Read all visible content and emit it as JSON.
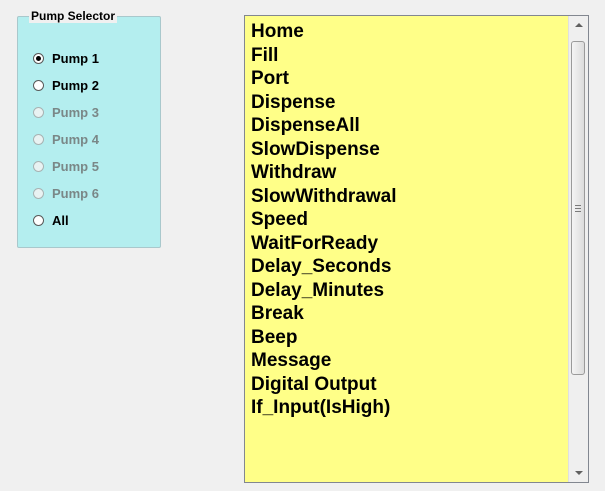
{
  "pump_selector": {
    "title": "Pump Selector",
    "options": [
      {
        "label": "Pump 1",
        "checked": true,
        "enabled": true
      },
      {
        "label": "Pump 2",
        "checked": false,
        "enabled": true
      },
      {
        "label": "Pump 3",
        "checked": false,
        "enabled": false
      },
      {
        "label": "Pump 4",
        "checked": false,
        "enabled": false
      },
      {
        "label": "Pump 5",
        "checked": false,
        "enabled": false
      },
      {
        "label": "Pump 6",
        "checked": false,
        "enabled": false
      },
      {
        "label": "All",
        "checked": false,
        "enabled": true
      }
    ]
  },
  "command_list": {
    "items": [
      "Home",
      "Fill",
      "Port",
      "Dispense",
      "DispenseAll",
      "SlowDispense",
      "Withdraw",
      "SlowWithdrawal",
      "Speed",
      "WaitForReady",
      "Delay_Seconds",
      "Delay_Minutes",
      "Break",
      "Beep",
      "Message",
      "Digital Output",
      "If_Input(IsHigh)"
    ],
    "scroll_position": 0
  },
  "colors": {
    "group_background": "#b4eeef",
    "list_background": "#ffff88",
    "window_background": "#f0f0f0",
    "disabled_text": "#7a8787"
  },
  "icons": {
    "scroll_up": "triangle-up-icon",
    "scroll_down": "triangle-down-icon",
    "thumb_grip": "grip-lines-icon"
  }
}
